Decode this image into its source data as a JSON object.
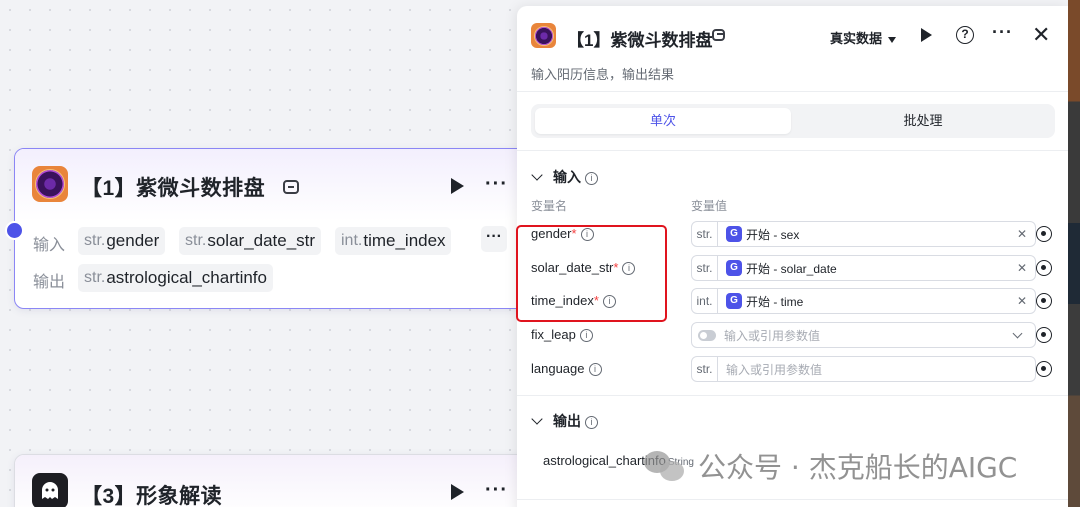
{
  "canvas": {
    "node1": {
      "title": "【1】紫微斗数排盘",
      "input_label": "输入",
      "output_label": "输出",
      "inputs": [
        {
          "type": "str.",
          "name": "gender"
        },
        {
          "type": "str.",
          "name": "solar_date_str"
        },
        {
          "type": "int.",
          "name": "time_index"
        }
      ],
      "outputs": [
        {
          "type": "str.",
          "name": "astrological_chartinfo"
        }
      ],
      "more_chip": "···"
    },
    "node3": {
      "title": "【3】形象解读"
    }
  },
  "panel": {
    "title": "【1】紫微斗数排盘",
    "description": "输入阳历信息，输出结果",
    "data_source": "真实数据",
    "tabs": [
      "单次",
      "批处理"
    ],
    "input_section": "输入",
    "col_name": "变量名",
    "col_value": "变量值",
    "params": [
      {
        "name": "gender",
        "required": "*",
        "type": "str.",
        "ref": "开始 - sex",
        "placeholder": ""
      },
      {
        "name": "solar_date_str",
        "required": "*",
        "type": "str.",
        "ref": "开始 - solar_date",
        "placeholder": ""
      },
      {
        "name": "time_index",
        "required": "*",
        "type": "int.",
        "ref": "开始 - time",
        "placeholder": ""
      },
      {
        "name": "fix_leap",
        "required": "",
        "type": "",
        "ref": "",
        "placeholder": "输入或引用参数值"
      },
      {
        "name": "language",
        "required": "",
        "type": "str.",
        "ref": "",
        "placeholder": "输入或引用参数值"
      }
    ],
    "output_section": "输出",
    "output_name": "astrological_chartinfo",
    "output_type": "String"
  },
  "watermark": "公众号 · 杰克船长的AIGC",
  "colors": {
    "accent": "#4d53e8",
    "node_border": "#8b86f5",
    "highlight_box": "#e0141e",
    "required": "#f53f3f"
  }
}
